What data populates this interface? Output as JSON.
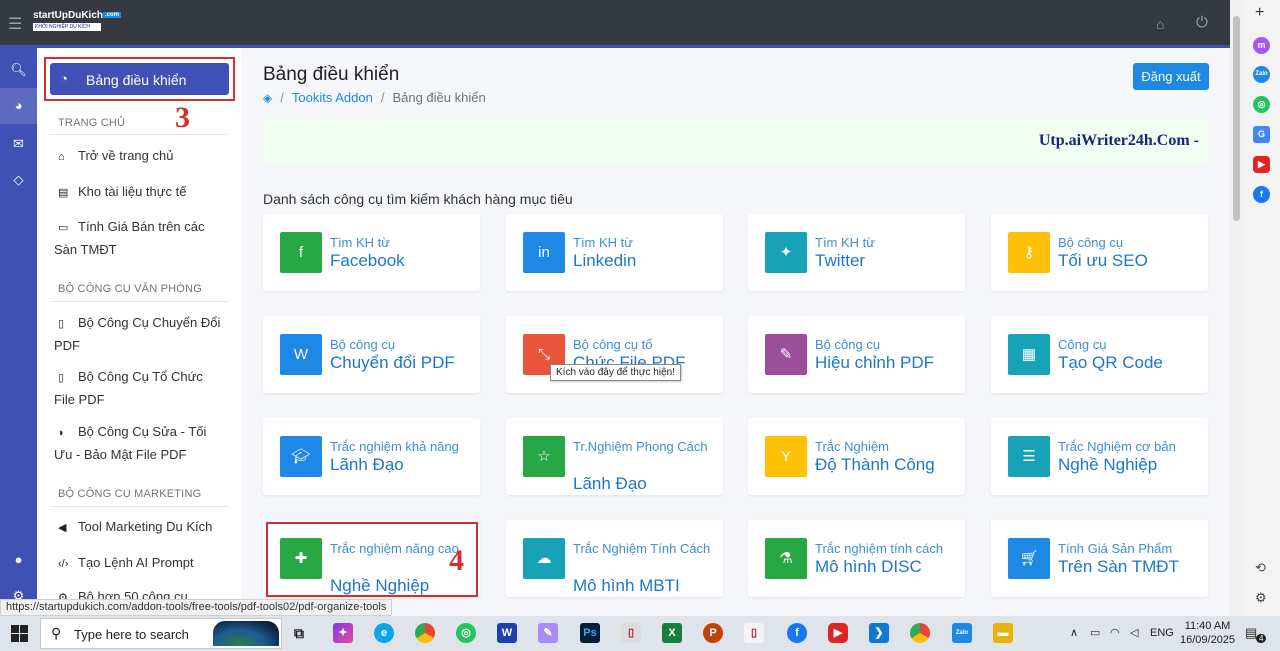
{
  "topbar": {
    "logo_line1": "startUpDuKich",
    "logo_com": ".com",
    "logo_line2": "KHỞI NGHIỆP DU KÍCH"
  },
  "sidebar": {
    "dashboard_label": "Bảng điều khiển",
    "annotation_3": "3",
    "section_home": "TRANG CHỦ",
    "home_items": [
      "Trở về trang chủ",
      "Kho tài liệu thực tế",
      "Tính Giá Bán trên các Sàn TMĐT"
    ],
    "section_office": "BỘ CÔNG CỤ VĂN PHÒNG",
    "office_items": [
      "Bộ Công Cụ Chuyển Đổi PDF",
      "Bộ Công Cụ Tổ Chức File PDF",
      "Bộ Công Cụ Sửa - Tối Ưu - Bảo Mật File PDF"
    ],
    "section_marketing": "BỘ CÔNG CỤ MARKETING",
    "marketing_items": [
      "Tool Marketing Du Kích",
      "Tạo Lệnh AI Prompt",
      "Bộ hơn 50 công cụ"
    ]
  },
  "main": {
    "title": "Bảng điều khiển",
    "logout_label": "Đăng xuất",
    "breadcrumb": [
      "Tookits Addon",
      "Bảng điều khiển"
    ],
    "banner_text": "Utp.aiWriter24h.Com -",
    "section_heading": "Danh sách công cụ tìm kiếm khách hàng mục tiêu",
    "annotation_4": "4",
    "tooltip": "Kích vào đây để thực hiện!",
    "cards": [
      {
        "sub": "Tìm KH từ",
        "main": "Facebook",
        "color": "#28a745"
      },
      {
        "sub": "Tìm KH từ",
        "main": "Linkedin",
        "color": "#1e88e5"
      },
      {
        "sub": "Tìm KH từ",
        "main": "Twitter",
        "color": "#17a2b8"
      },
      {
        "sub": "Bộ công cụ",
        "main": "Tối ưu SEO",
        "color": "#ffc107"
      },
      {
        "sub": "Bộ công cụ",
        "main": "Chuyển đổi PDF",
        "color": "#1e88e5"
      },
      {
        "sub": "Bộ công cụ tổ",
        "main": "Chức File PDF",
        "color": "#e8553a"
      },
      {
        "sub": "Bộ công cụ",
        "main": "Hiệu chỉnh PDF",
        "color": "#9b4f9b"
      },
      {
        "sub": "Công cụ",
        "main": "Tạo QR Code",
        "color": "#17a2b8"
      },
      {
        "sub": "Trắc nghiệm khả năng",
        "main": "Lãnh Đạo",
        "color": "#1e88e5"
      },
      {
        "sub": "Tr.Nghiệm Phong Cách",
        "main": "Lãnh Đạo",
        "color": "#28a745"
      },
      {
        "sub": "Trắc Nghiệm",
        "main": "Độ Thành Công",
        "color": "#ffc107"
      },
      {
        "sub": "Trắc Nghiệm cơ bản",
        "main": "Nghề Nghiệp",
        "color": "#17a2b8"
      },
      {
        "sub": "Trắc nghiệm năng cao",
        "main": "Nghề Nghiệp",
        "color": "#28a745"
      },
      {
        "sub": "Trắc Nghiệm Tính Cách",
        "main": "Mô hình MBTI",
        "color": "#17a2b8"
      },
      {
        "sub": "Trắc nghiệm tính cách",
        "main": "Mô hình DISC",
        "color": "#28a745"
      },
      {
        "sub": "Tính Giá Sản Phẩm",
        "main": "Trên Sàn TMĐT",
        "color": "#1e88e5"
      }
    ]
  },
  "status_url": "https://startupdukich.com/addon-tools/free-tools/pdf-tools02/pdf-organize-tools",
  "taskbar": {
    "search_placeholder": "Type here to search",
    "language": "ENG",
    "time": "11:40 AM",
    "date": "16/09/2025",
    "notification_count": "4"
  }
}
